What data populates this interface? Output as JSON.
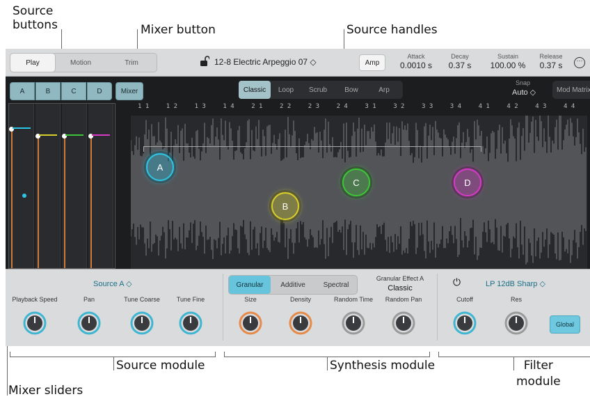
{
  "callouts": {
    "source_buttons": "Source\nbuttons",
    "mixer_button": "Mixer button",
    "source_handles": "Source handles",
    "source_module": "Source module",
    "synthesis_module": "Synthesis module",
    "filter_module": "Filter\nmodule",
    "mixer_sliders": "Mixer sliders"
  },
  "topbar": {
    "view_tabs": [
      "Play",
      "Motion",
      "Trim"
    ],
    "selected_tab": "Play",
    "preset": "12-8 Electric Arpeggio 07 ◇",
    "amp_label": "Amp",
    "envelope": [
      {
        "label": "Attack",
        "value": "0.0010 s"
      },
      {
        "label": "Decay",
        "value": "0.37 s"
      },
      {
        "label": "Sustain",
        "value": "100.00 %"
      },
      {
        "label": "Release",
        "value": "0.37 s"
      }
    ],
    "more_glyph": "⋯"
  },
  "row2": {
    "sources": [
      "A",
      "B",
      "C",
      "D"
    ],
    "mixer_label": "Mixer",
    "play_modes": [
      "Classic",
      "Loop",
      "Scrub",
      "Bow",
      "Arp"
    ],
    "selected_mode": "Classic",
    "snap_label": "Snap",
    "snap_value": "Auto ◇",
    "mod_matrix_label": "Mod Matrix"
  },
  "ruler_ticks": [
    "1 1",
    "1 2",
    "1 3",
    "1 4",
    "2 1",
    "2 2",
    "2 3",
    "2 4",
    "3 1",
    "3 2",
    "3 3",
    "3 4",
    "4 1",
    "4 2",
    "4 3",
    "4 4",
    "5 1"
  ],
  "handles": [
    {
      "label": "A",
      "color": "#2ec6e6"
    },
    {
      "label": "B",
      "color": "#d9cf2a"
    },
    {
      "label": "C",
      "color": "#3fc43a"
    },
    {
      "label": "D",
      "color": "#d63ac6"
    }
  ],
  "mixer_colors": [
    "#2ec6e6",
    "#d9cf2a",
    "#3fc43a",
    "#d63ac6"
  ],
  "source_module": {
    "title": "Source A ◇",
    "params": [
      "Playback Speed",
      "Pan",
      "Tune Coarse",
      "Tune Fine"
    ]
  },
  "synthesis_module": {
    "types": [
      "Granular",
      "Additive",
      "Spectral"
    ],
    "selected_type": "Granular",
    "effect_label": "Granular Effect A",
    "effect_value": "Classic",
    "params": [
      "Size",
      "Density",
      "Random Time",
      "Random Pan"
    ]
  },
  "filter_module": {
    "power_glyph": "⏻",
    "filter_type": "LP 12dB Sharp ◇",
    "params": [
      "Cutoff",
      "Res"
    ],
    "global_label": "Global"
  },
  "colors": {
    "accent": "#2ec6e6",
    "source_btn": "#8fb8c1"
  }
}
